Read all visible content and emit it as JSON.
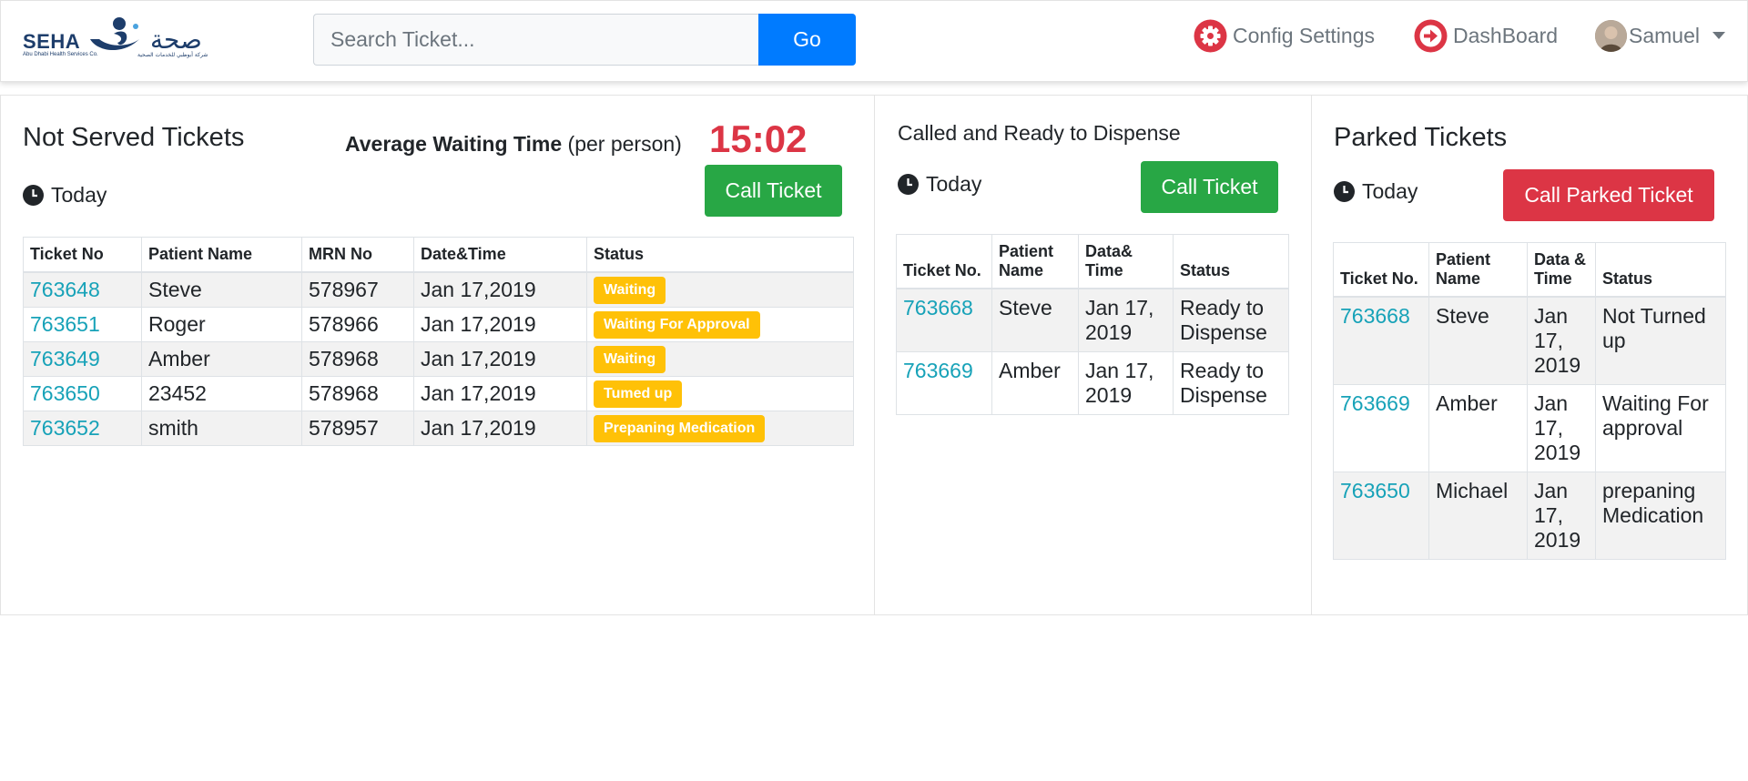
{
  "header": {
    "logo": {
      "en": "SEHA",
      "en_sub": "Abu Dhabi Health Services Co.",
      "ar": "صحة",
      "ar_sub": "شركة أبوظبي للخدمات الصحية"
    },
    "search": {
      "placeholder": "Search Ticket...",
      "value": ""
    },
    "go_label": "Go",
    "nav": {
      "config": "Config Settings",
      "dashboard": "DashBoard",
      "user": "Samuel"
    }
  },
  "not_served": {
    "title": "Not Served Tickets",
    "avg_label": "Average Waiting Time",
    "avg_sub": " (per person)",
    "avg_time": "15:02",
    "today": "Today",
    "call_button": "Call Ticket",
    "columns": [
      "Ticket No",
      "Patient Name",
      "MRN No",
      "Date&Time",
      "Status"
    ],
    "rows": [
      {
        "ticket": "763648",
        "name": "Steve",
        "mrn": "578967",
        "date": "Jan 17,2019",
        "status": "Waiting"
      },
      {
        "ticket": "763651",
        "name": "Roger",
        "mrn": "578966",
        "date": "Jan 17,2019",
        "status": "Waiting For Approval"
      },
      {
        "ticket": "763649",
        "name": "Amber",
        "mrn": "578968",
        "date": "Jan 17,2019",
        "status": "Waiting"
      },
      {
        "ticket": "763650",
        "name": "23452",
        "mrn": "578968",
        "date": "Jan 17,2019",
        "status": "Tumed up"
      },
      {
        "ticket": "763652",
        "name": "smith",
        "mrn": "578957",
        "date": "Jan 17,2019",
        "status": "Prepaning Medication"
      }
    ]
  },
  "dispense": {
    "title": "Called and Ready to Dispense",
    "today": "Today",
    "call_button": "Call Ticket",
    "columns": [
      "Ticket No.",
      "Patient Name",
      "Data& Time",
      "Status"
    ],
    "rows": [
      {
        "ticket": "763668",
        "name": "Steve",
        "date": "Jan 17, 2019",
        "status": "Ready to Dispense"
      },
      {
        "ticket": "763669",
        "name": "Amber",
        "date": "Jan 17, 2019",
        "status": "Ready to Dispense"
      }
    ]
  },
  "parked": {
    "title": "Parked Tickets",
    "today": "Today",
    "call_button": "Call Parked Ticket",
    "columns": [
      "Ticket No.",
      "Patient Name",
      "Data & Time",
      "Status"
    ],
    "rows": [
      {
        "ticket": "763668",
        "name": "Steve",
        "date": "Jan 17, 2019",
        "status": "Not Turned up"
      },
      {
        "ticket": "763669",
        "name": "Amber",
        "date": "Jan 17, 2019",
        "status": "Waiting For approval"
      },
      {
        "ticket": "763650",
        "name": "Michael",
        "date": "Jan 17, 2019",
        "status": "prepaning Medication"
      }
    ]
  }
}
